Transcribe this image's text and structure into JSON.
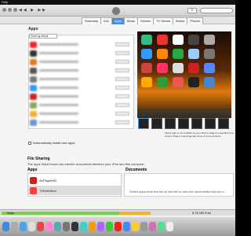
{
  "menubar": {
    "items": [
      "Help"
    ]
  },
  "toolbar": {
    "list_icon": "list-icon",
    "search_icon": "search-icon"
  },
  "nav": {
    "tabs": [
      "Summary",
      "Info",
      "Apps",
      "Music",
      "Movies",
      "TV Shows",
      "Books",
      "Photos"
    ],
    "active": "Apps"
  },
  "apps_section": {
    "title": "Apps",
    "sort_label": "Sort by Kind"
  },
  "auto_sync": {
    "label": "Automatically install new apps"
  },
  "screen_hint": {
    "text": "Select apps to be installed on your iPad or drag to a specific home screen. Drag to rearrange app icons or home screens."
  },
  "file_sharing": {
    "title": "File Sharing",
    "description": "The apps listed below can transfer documents between your iPad and this computer.",
    "apps_header": "Apps",
    "documents_header": "Documents",
    "apps": [
      {
        "name": "AVPlayerHD"
      },
      {
        "name": "TVDefinition"
      }
    ],
    "documents_placeholder": "Select apps from the list on the left to view the documents that are o..."
  },
  "capacity": {
    "label": "Apps",
    "free_label": "5.76 GB Free"
  },
  "colors": {
    "accent": "#4a8fe0",
    "apps_bar": "#7bd04a"
  }
}
